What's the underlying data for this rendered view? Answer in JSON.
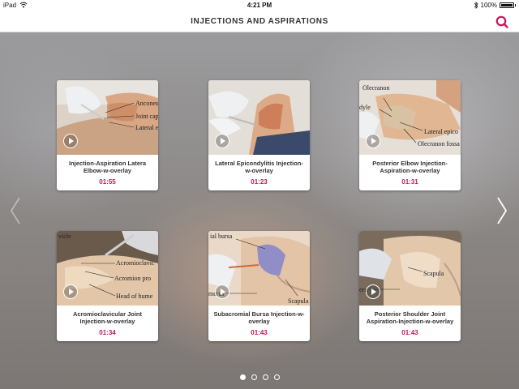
{
  "status_bar": {
    "device": "iPad",
    "time": "4:21 PM",
    "battery": "100%"
  },
  "header": {
    "title": "INJECTIONS AND ASPIRATIONS",
    "accent_color": "#c2185b"
  },
  "videos": [
    {
      "title": "Injection-Aspiration Latera Elbow-w-overlay",
      "duration": "01:55",
      "labels": [
        "Anconeu",
        "Joint cap",
        "Lateral e"
      ]
    },
    {
      "title": "Lateral Epicondylitis Injection-w-overlay",
      "duration": "01:23",
      "labels": []
    },
    {
      "title": "Posterior Elbow Injection-Aspiration-w-overlay",
      "duration": "01:31",
      "labels": [
        "Olecranon",
        "dyle",
        "Lateral epico",
        "Olecranon fossa"
      ]
    },
    {
      "title": "Acromioclavicular Joint Injection-w-overlay",
      "duration": "01:34",
      "labels": [
        "vicle",
        "Acromioclavic",
        "Acromion pro",
        "Head of hume"
      ]
    },
    {
      "title": "Subacromial Bursa Injection-w-overlay",
      "duration": "01:43",
      "labels": [
        "ial bursa",
        "Scapula",
        "merus"
      ]
    },
    {
      "title": "Posterior Shoulder Joint Aspiration-Injection-w-overlay",
      "duration": "01:43",
      "labels": [
        "Scapula",
        "eru"
      ]
    }
  ],
  "icons": {
    "search": "search-icon",
    "play": "play-icon",
    "prev": "chevron-left-icon",
    "next": "chevron-right-icon",
    "wifi": "wifi-icon",
    "bluetooth": "bluetooth-icon",
    "battery": "battery-icon"
  },
  "pager": {
    "pages": 4,
    "active_index": 0
  }
}
